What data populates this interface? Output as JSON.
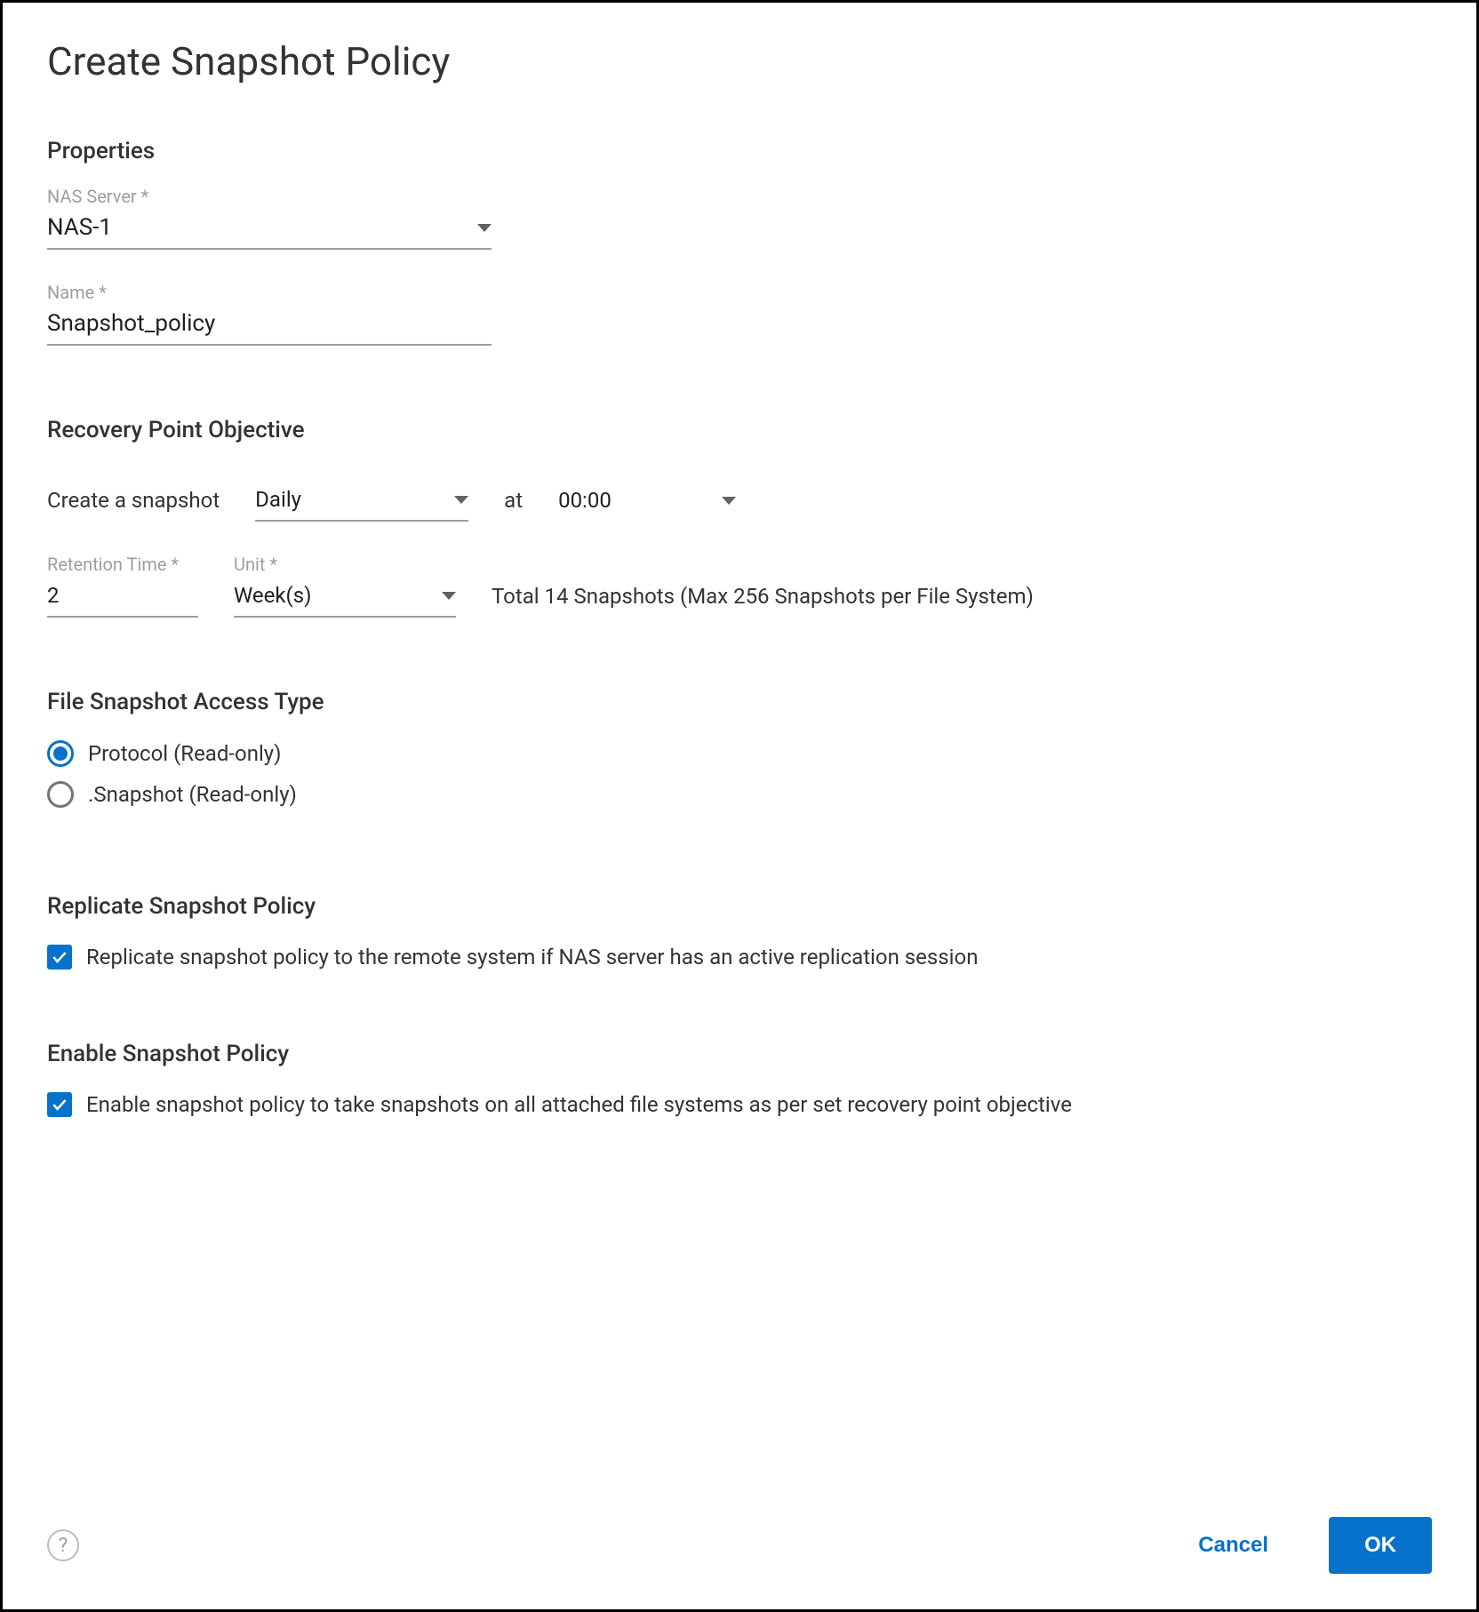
{
  "dialog": {
    "title": "Create Snapshot Policy"
  },
  "sections": {
    "properties": {
      "header": "Properties",
      "nas_server_label": "NAS Server *",
      "nas_server_value": "NAS-1",
      "name_label": "Name *",
      "name_value": "Snapshot_policy"
    },
    "rpo": {
      "header": "Recovery Point Objective",
      "create_label": "Create a snapshot",
      "frequency_value": "Daily",
      "at_label": "at",
      "time_value": "00:00",
      "retention_label": "Retention Time *",
      "retention_value": "2",
      "unit_label": "Unit *",
      "unit_value": "Week(s)",
      "summary": "Total 14 Snapshots (Max 256 Snapshots per File System)"
    },
    "access": {
      "header": "File Snapshot Access Type",
      "option_protocol": "Protocol (Read-only)",
      "option_snapshot": ".Snapshot (Read-only)",
      "selected": "protocol"
    },
    "replicate": {
      "header": "Replicate Snapshot Policy",
      "label": "Replicate snapshot policy to the remote system if NAS server has an active replication session",
      "checked": true
    },
    "enable": {
      "header": "Enable Snapshot Policy",
      "label": "Enable snapshot policy to take snapshots on all attached file systems as per set recovery point objective",
      "checked": true
    }
  },
  "footer": {
    "help_glyph": "?",
    "cancel": "Cancel",
    "ok": "OK"
  }
}
